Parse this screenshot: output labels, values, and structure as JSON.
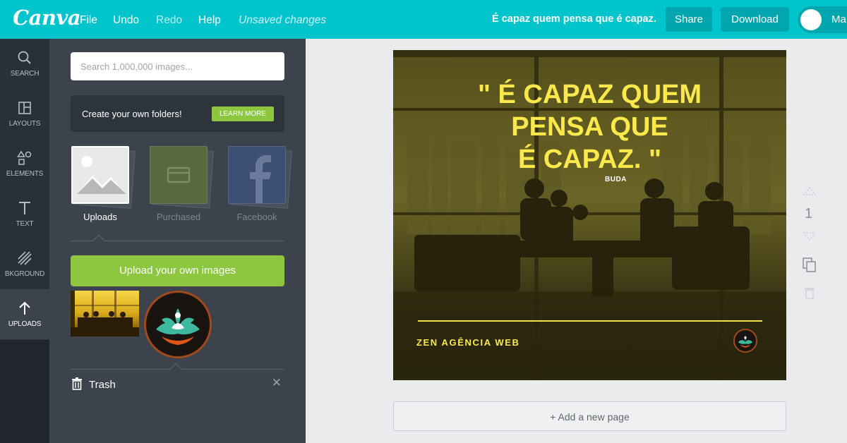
{
  "header": {
    "logo": "Canva",
    "menu": [
      "File",
      "Undo",
      "Redo",
      "Help"
    ],
    "status": "Unsaved changes",
    "doc_title": "É capaz quem pensa que é capaz.",
    "share_label": "Share",
    "download_label": "Download",
    "user_name": "Ma"
  },
  "sidebar": {
    "items": [
      {
        "label": "SEARCH",
        "icon": "search-icon"
      },
      {
        "label": "LAYOUTS",
        "icon": "layouts-icon"
      },
      {
        "label": "ELEMENTS",
        "icon": "elements-icon"
      },
      {
        "label": "TEXT",
        "icon": "text-icon"
      },
      {
        "label": "BKGROUND",
        "icon": "background-icon"
      },
      {
        "label": "UPLOADS",
        "icon": "upload-arrow-icon",
        "active": true
      }
    ]
  },
  "panel": {
    "search_placeholder": "Search 1,000,000 images...",
    "folders_text": "Create your own folders!",
    "learn_more": "LEARN MORE",
    "tabs": [
      {
        "label": "Uploads",
        "active": true
      },
      {
        "label": "Purchased"
      },
      {
        "label": "Facebook"
      }
    ],
    "upload_button": "Upload your own images",
    "trash_label": "Trash",
    "trash_close": "✕"
  },
  "design": {
    "quote_lines": [
      "\" É CAPAZ QUEM",
      "PENSA QUE",
      "É CAPAZ. \""
    ],
    "author": "BUDA",
    "brand": "ZEN AGÊNCIA WEB"
  },
  "page_controls": {
    "page_number": "1",
    "add_page": "+ Add a new page"
  },
  "colors": {
    "topbar": "#00c4cc",
    "button_dark": "#00a6ad",
    "accent_green": "#8dc63f",
    "nav_bg": "#293039",
    "panel_bg": "#3d434d",
    "quote_yellow": "#fbe94c"
  }
}
